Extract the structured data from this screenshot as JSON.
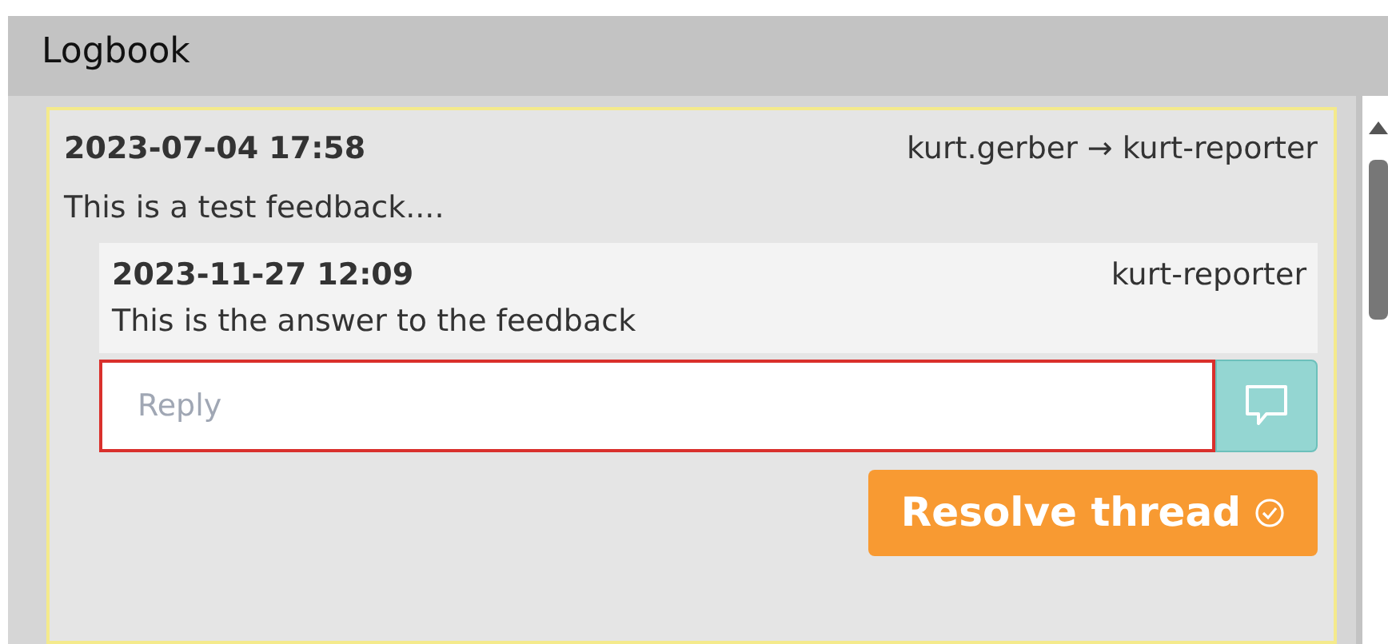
{
  "panel": {
    "title": "Logbook"
  },
  "thread": {
    "date": "2023-07-04 17:58",
    "author": "kurt.gerber → kurt-reporter",
    "message": "This is a test feedback....",
    "replies": [
      {
        "date": "2023-11-27 12:09",
        "author": "kurt-reporter",
        "message": "This is the answer to the feedback"
      }
    ],
    "reply_field": {
      "placeholder": "Reply",
      "invalid": true
    },
    "resolve_button": {
      "label": "Resolve thread"
    }
  }
}
